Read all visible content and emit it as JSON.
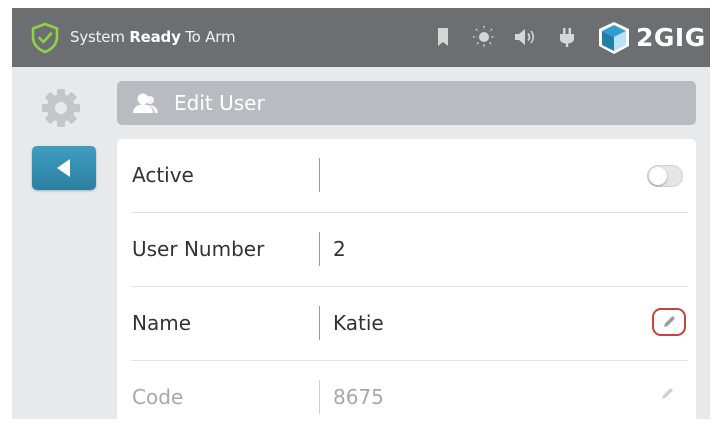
{
  "statusbar": {
    "status_prefix": "System ",
    "status_bold": "Ready",
    "status_suffix": " To Arm",
    "brand": "2GIG",
    "icons": [
      "shield-check-icon",
      "bookmark-icon",
      "brightness-icon",
      "volume-icon",
      "power-plug-icon",
      "brand-cube-icon"
    ]
  },
  "header": {
    "title": "Edit User",
    "icon": "user-icon"
  },
  "rows": [
    {
      "label": "Active",
      "value": "",
      "control": "toggle",
      "toggle_on": false
    },
    {
      "label": "User Number",
      "value": "2"
    },
    {
      "label": "Name",
      "value": "Katie",
      "control": "edit-button"
    },
    {
      "label": "Code",
      "value": "8675",
      "control": "edit-button-dim"
    }
  ],
  "colors": {
    "statusbar": "#6d6e71",
    "header": "#b8bcc0",
    "back_button": "#2f88ad",
    "edit_highlight": "#c8423f",
    "shield": "#8ed14a"
  }
}
